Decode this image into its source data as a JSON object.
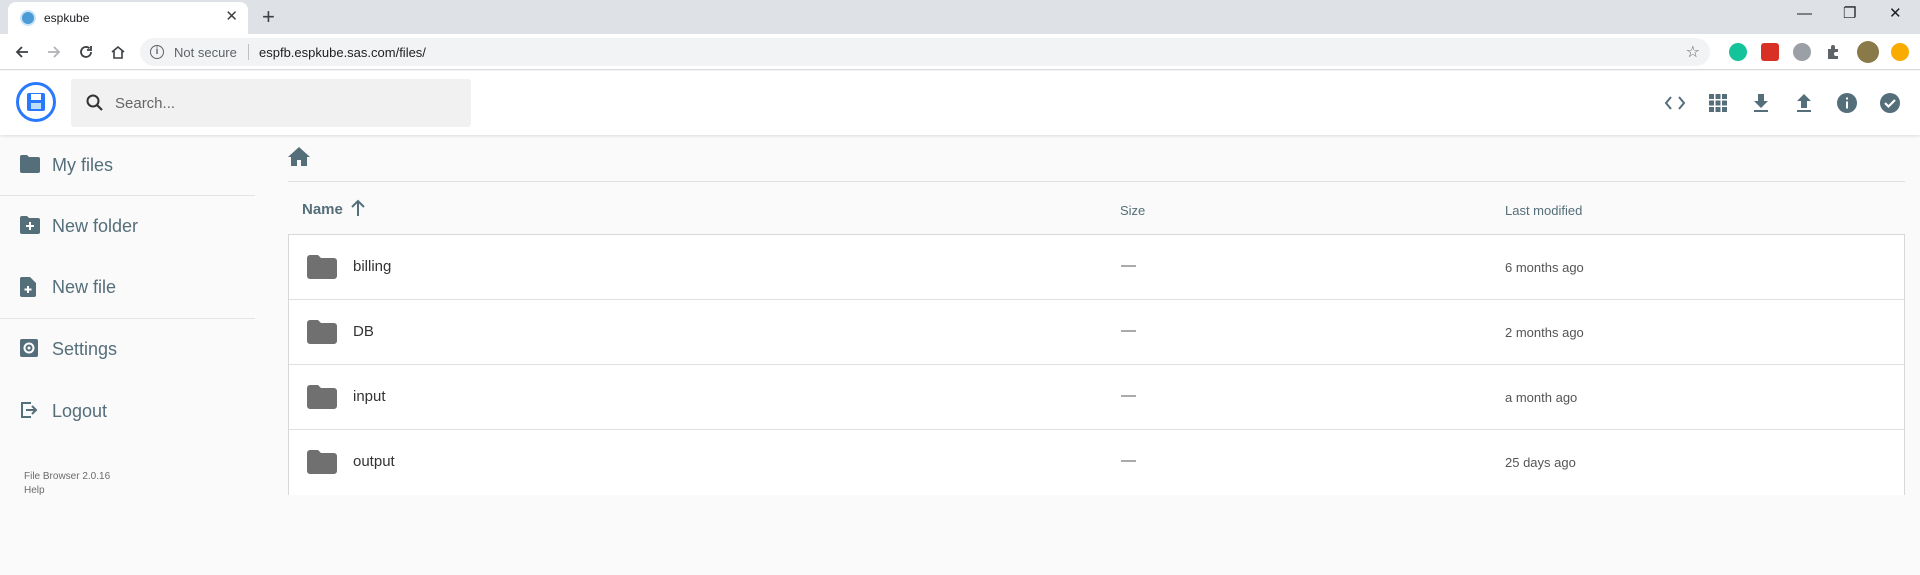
{
  "browser": {
    "tab_title": "espkube",
    "tab_close": "✕",
    "new_tab": "+",
    "window_controls": {
      "minimize": "—",
      "restore": "❐",
      "close": "✕"
    },
    "security_label": "Not secure",
    "url": "espfb.espkube.sas.com/files/",
    "star": "☆"
  },
  "app": {
    "search_placeholder": "Search...",
    "header_actions": [
      "code-icon",
      "grid-view-icon",
      "download-icon",
      "upload-icon",
      "info-icon",
      "select-check-icon"
    ]
  },
  "sidebar": {
    "items": [
      {
        "label": "My files",
        "icon": "folder-icon"
      },
      {
        "label": "New folder",
        "icon": "create-folder-icon"
      },
      {
        "label": "New file",
        "icon": "note-add-icon"
      },
      {
        "label": "Settings",
        "icon": "settings-icon"
      },
      {
        "label": "Logout",
        "icon": "exit-icon"
      }
    ],
    "version": "File Browser 2.0.16",
    "help": "Help"
  },
  "listing": {
    "columns": {
      "name": "Name",
      "size": "Size",
      "modified": "Last modified"
    },
    "sort": "ascending",
    "rows": [
      {
        "name": "billing",
        "size": "—",
        "modified": "6 months ago"
      },
      {
        "name": "DB",
        "size": "—",
        "modified": "2 months ago"
      },
      {
        "name": "input",
        "size": "—",
        "modified": "a month ago"
      },
      {
        "name": "output",
        "size": "—",
        "modified": "25 days ago"
      }
    ]
  },
  "colors": {
    "accent": "#2979ff",
    "sidebar_text": "#546e7a",
    "folder_icon": "#707070",
    "page_bg": "#fafafa"
  }
}
